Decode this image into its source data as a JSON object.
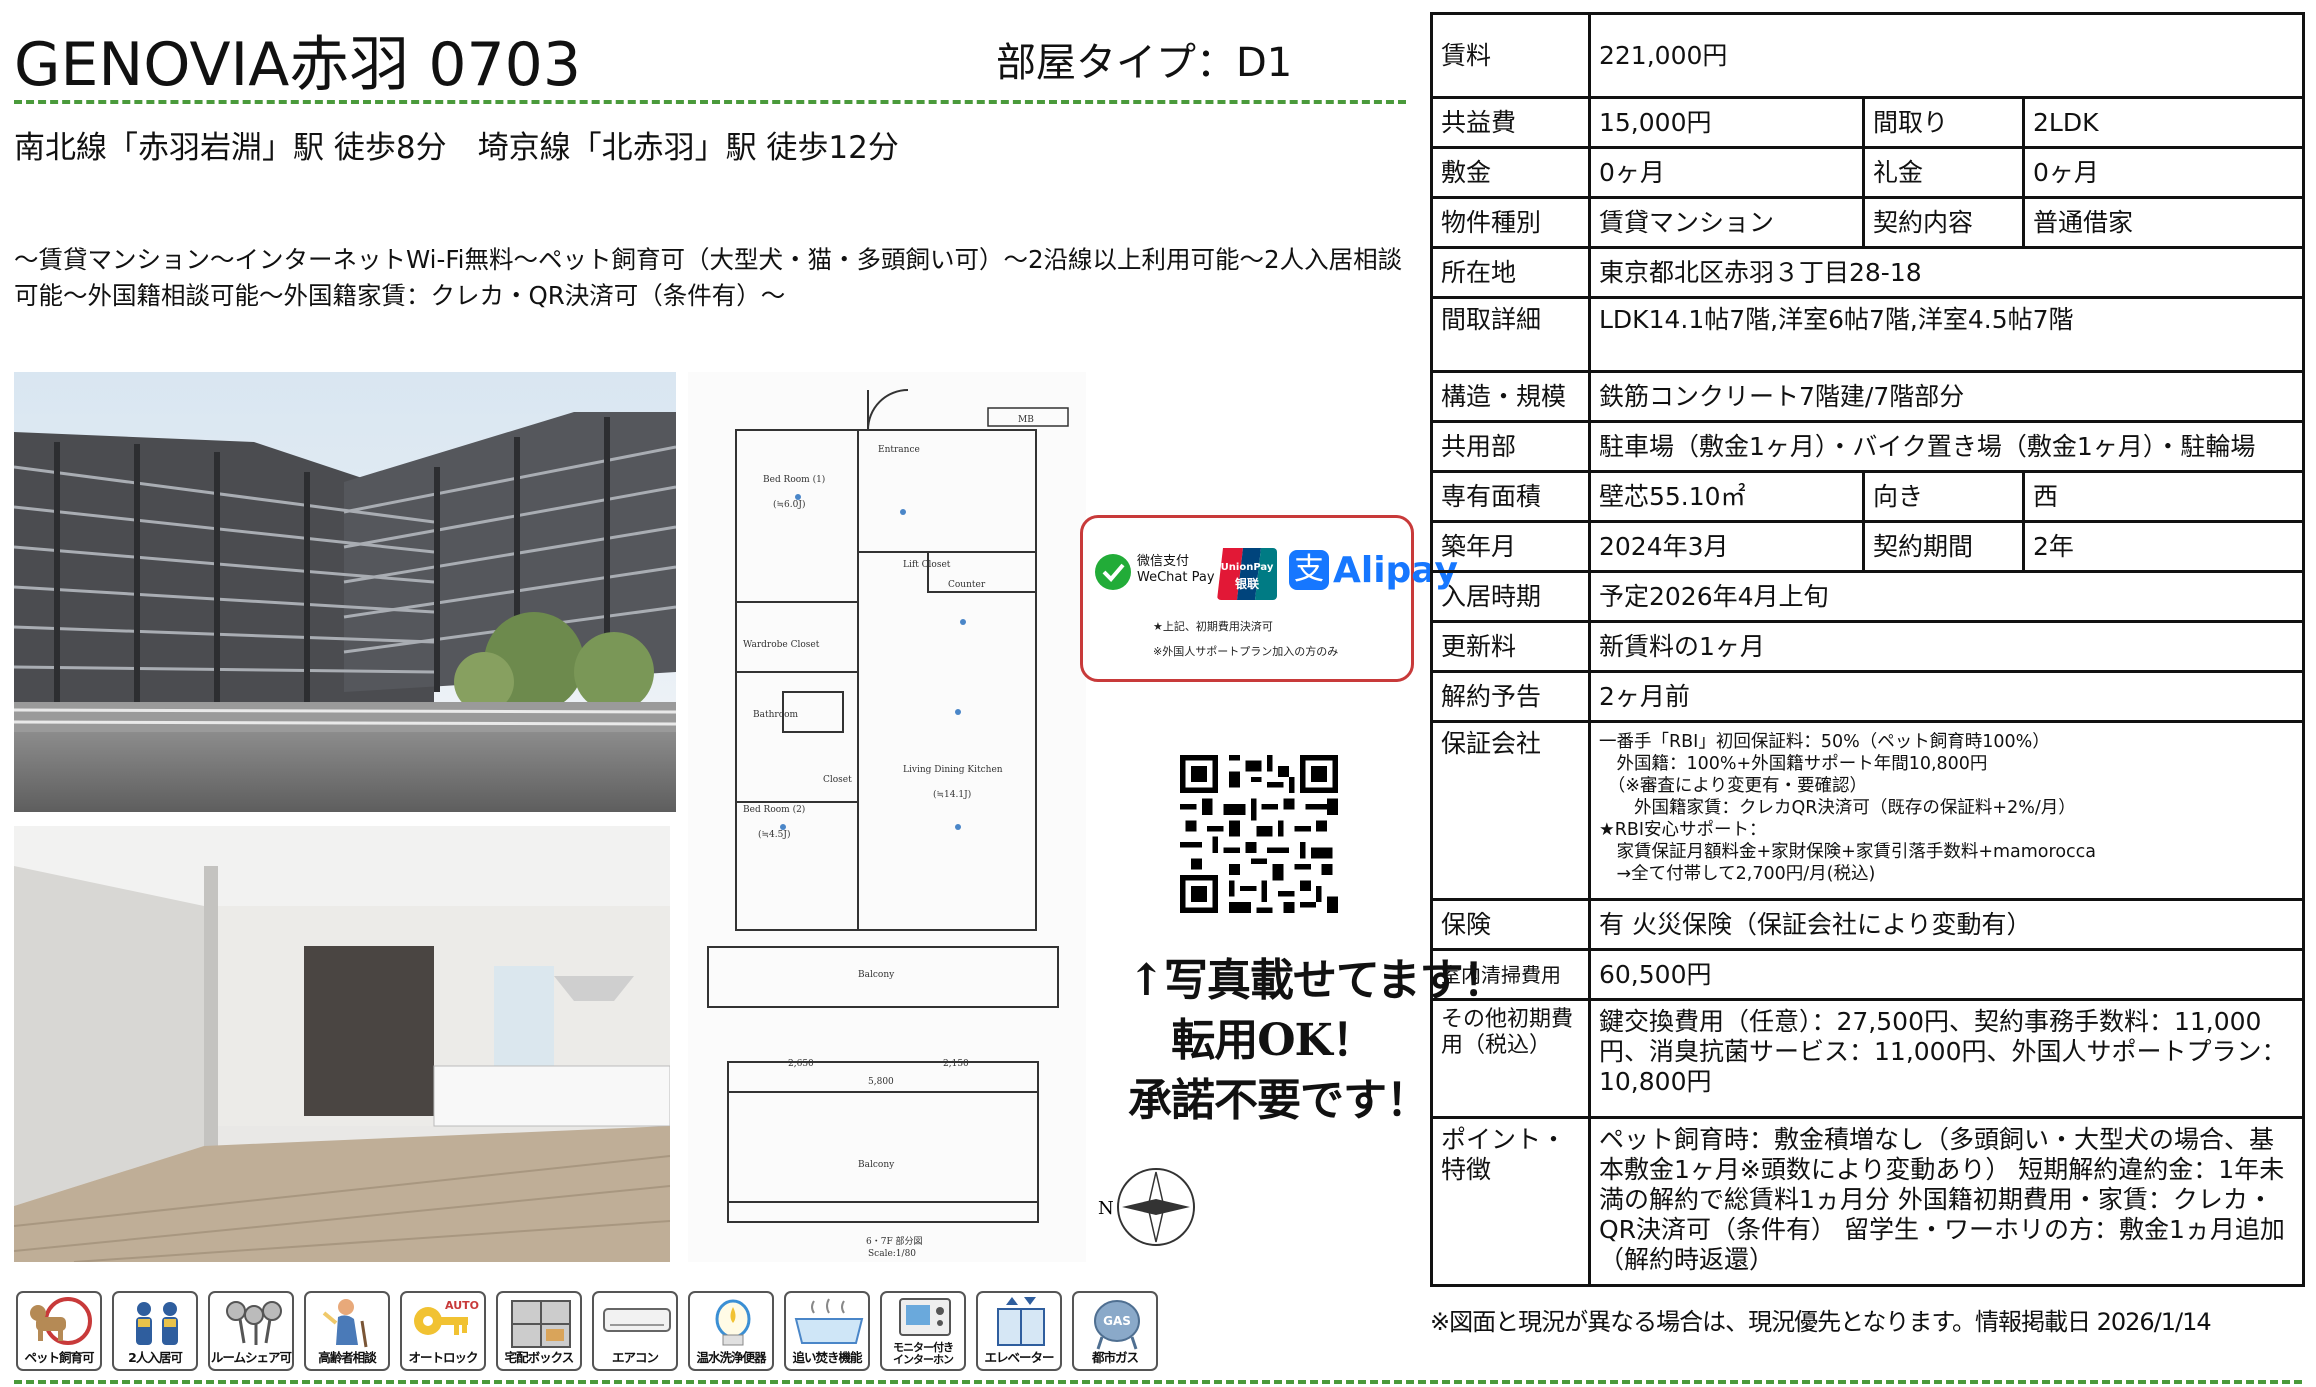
{
  "header": {
    "title": "GENOVIA赤羽 0703",
    "room_type": "部屋タイプ：D1",
    "station": "南北線「赤羽岩淵」駅 徒歩8分　埼京線「北赤羽」駅 徒歩12分",
    "catchphrase": "～賃貸マンション～インターネットWi-Fi無料～ペット飼育可（大型犬・猫・多頭飼い可）～2沿線以上利用可能～2人入居相談可能～外国籍相談可能～外国籍家賃：クレカ・QR決済可（条件有）～"
  },
  "floor_plan": {
    "rooms": [
      "Bed Room (1)",
      "Bed Room (2)",
      "Living Dining Kitchen",
      "Balcony",
      "Bathroom",
      "Entrance",
      "Counter"
    ],
    "room_sizes": [
      "(≒6.0J)",
      "(≒4.5J)",
      "(≒14.1J)"
    ],
    "labels": [
      "MB",
      "Lift Closet",
      "Closet",
      "Wardrobe Closet"
    ],
    "dimensions": [
      "2,650",
      "2,150",
      "5,800"
    ],
    "caption": "6・7F 部分図",
    "scale": "Scale:1/80",
    "compass_label": "N"
  },
  "payment": {
    "wechat": "微信支付",
    "wechat_en": "WeChat Pay",
    "unionpay": "UnionPay",
    "unionpay_cn": "银联",
    "alipay": "Alipay",
    "alipay_mark": "支",
    "note1": "★上記、初期費用決済可",
    "note2": "※外国人サポートプラン加入の方のみ"
  },
  "handwritten": {
    "line1": "↑写真載せてます！",
    "line2": "転用OK！",
    "line3": "承諾不要です！"
  },
  "features": [
    {
      "label": "ペット飼育可",
      "icon": "pet-icon"
    },
    {
      "label": "2人入居可",
      "icon": "two-people-icon"
    },
    {
      "label": "ルームシェア可",
      "icon": "room-share-icon"
    },
    {
      "label": "高齢者相談",
      "icon": "elderly-icon"
    },
    {
      "label": "オートロック",
      "icon": "autolock-icon",
      "badge": "AUTO"
    },
    {
      "label": "宅配ボックス",
      "icon": "delivery-box-icon"
    },
    {
      "label": "エアコン",
      "icon": "air-conditioner-icon"
    },
    {
      "label": "温水洗浄便器",
      "icon": "washlet-icon"
    },
    {
      "label": "追い焚き機能",
      "icon": "reheat-bath-icon"
    },
    {
      "label": "モニター付き\nインターホン",
      "icon": "monitor-intercom-icon"
    },
    {
      "label": "エレベーター",
      "icon": "elevator-icon"
    },
    {
      "label": "都市ガス",
      "icon": "city-gas-icon",
      "badge": "GAS"
    }
  ],
  "details": {
    "rent_label": "賃料",
    "rent": "221,000円",
    "common_fee_label": "共益費",
    "common_fee": "15,000円",
    "layout_label": "間取り",
    "layout": "2LDK",
    "deposit_label": "敷金",
    "deposit": "0ヶ月",
    "key_money_label": "礼金",
    "key_money": "0ヶ月",
    "type_label": "物件種別",
    "type": "賃貸マンション",
    "contract_label": "契約内容",
    "contract": "普通借家",
    "address_label": "所在地",
    "address": "東京都北区赤羽３丁目28-18",
    "layout_detail_label": "間取詳細",
    "layout_detail": "LDK14.1帖7階,洋室6帖7階,洋室4.5帖7階",
    "structure_label": "構造・規模",
    "structure": "鉄筋コンクリート7階建/7階部分",
    "shared_label": "共用部",
    "shared": "駐車場（敷金1ヶ月）・バイク置き場（敷金1ヶ月）・駐輪場",
    "area_label": "専有面積",
    "area": "壁芯55.10㎡",
    "direction_label": "向き",
    "direction": "西",
    "built_label": "築年月",
    "built": "2024年3月",
    "term_label": "契約期間",
    "term": "2年",
    "move_in_label": "入居時期",
    "move_in": "予定2026年4月上旬",
    "renewal_label": "更新料",
    "renewal": "新賃料の1ヶ月",
    "cancel_label": "解約予告",
    "cancel": "2ヶ月前",
    "guarantor_label": "保証会社",
    "guarantor_lines": [
      "一番手「RBI」初回保証料：50%（ペット飼育時100%）",
      "　外国籍：100%+外国籍サポート年間10,800円",
      "　（※審査により変更有・要確認）",
      "　　外国籍家賃：クレカQR決済可（既存の保証料+2%/月）",
      "★RBI安心サポート：",
      "　家賃保証月額料金+家財保険+家賃引落手数料+mamorocca",
      "　→全て付帯して2,700円/月(税込)"
    ],
    "insurance_label": "保険",
    "insurance": "有 火災保険（保証会社により変動有）",
    "cleaning_label": "室内清掃費用",
    "cleaning": "60,500円",
    "other_label": "その他初期費用（税込）",
    "other": "鍵交換費用（任意）：27,500円、契約事務手数料：11,000円、消臭抗菌サービス：11,000円、外国人サポートプラン：10,800円",
    "points_label": "ポイント・特徴",
    "points": "ペット飼育時：敷金積増なし（多頭飼い・大型犬の場合、基本敷金1ヶ月※頭数により変動あり） 短期解約違約金：1年未満の解約で総賃料1ヵ月分 外国籍初期費用・家賃：クレカ・QR決済可（条件有） 留学生・ワーホリの方：敷金1ヵ月追加（解約時返還）"
  },
  "footer": {
    "note": "※図面と現況が異なる場合は、現況優先となります。情報掲載日 2026/1/14"
  }
}
